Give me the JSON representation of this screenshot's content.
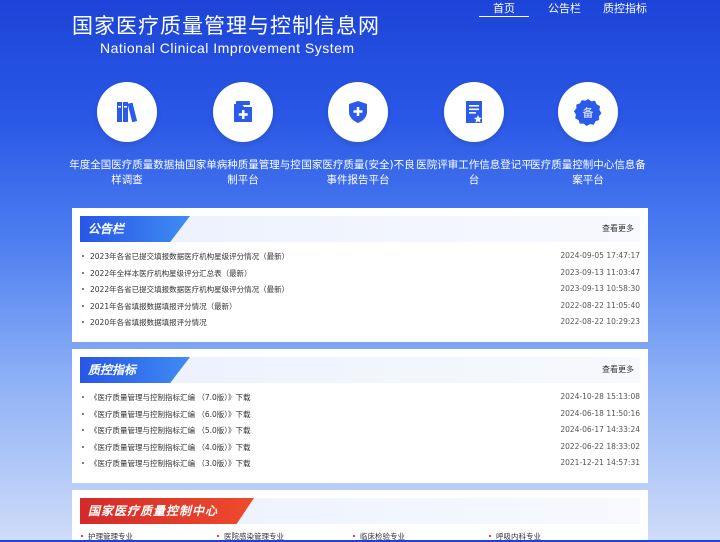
{
  "header": {
    "title": "国家医疗质量管理与控制信息网",
    "subtitle": "National Clinical Improvement System",
    "nav": [
      {
        "label": "首页",
        "active": true
      },
      {
        "label": "公告栏",
        "active": false
      },
      {
        "label": "质控指标",
        "active": false
      }
    ]
  },
  "platforms": [
    {
      "icon": "books-icon",
      "label": "年度全国医疗质量数据抽样调查"
    },
    {
      "icon": "medical-folder-icon",
      "label": "国家单病种质量管理与控制平台"
    },
    {
      "icon": "shield-plus-icon",
      "label": "国家医疗质量(安全)不良事件报告平台"
    },
    {
      "icon": "certificate-icon",
      "label": "医院评审工作信息登记平台"
    },
    {
      "icon": "record-badge-icon",
      "label": "医疗质量控制中心信息备案平台"
    }
  ],
  "badge_glyph": "备",
  "announcements": {
    "title": "公告栏",
    "more": "查看更多",
    "items": [
      {
        "text": "2023年各省已提交填报数据医疗机构星级评分情况（最新）",
        "date": "2024-09-05 17:47:17"
      },
      {
        "text": "2022年全样本医疗机构星级评分汇总表（最新）",
        "date": "2023-09-13 11:03:47"
      },
      {
        "text": "2022年各省已提交填报数据医疗机构星级评分情况（最新）",
        "date": "2023-09-13 10:58:30"
      },
      {
        "text": "2021年各省填报数据填报评分情况（最新）",
        "date": "2022-08-22 11:05:40"
      },
      {
        "text": "2020年各省填报数据填报评分情况",
        "date": "2022-08-22 10:29:23"
      }
    ]
  },
  "indicators": {
    "title": "质控指标",
    "more": "查看更多",
    "items": [
      {
        "text": "《医疗质量管理与控制指标汇编 （7.0版）》下载",
        "date": "2024-10-28 15:13:08"
      },
      {
        "text": "《医疗质量管理与控制指标汇编 （6.0版）》下载",
        "date": "2024-06-18 11:50:16"
      },
      {
        "text": "《医疗质量管理与控制指标汇编 （5.0版）》下载",
        "date": "2024-06-17 14:33:24"
      },
      {
        "text": "《医疗质量管理与控制指标汇编 （4.0版）》下载",
        "date": "2022-06-22 18:33:02"
      },
      {
        "text": "《医疗质量管理与控制指标汇编 （3.0版）》下载",
        "date": "2021-12-21 14:57:31"
      }
    ]
  },
  "control_center": {
    "title": "国家医疗质量控制中心",
    "items": [
      "护理管理专业",
      "医院感染管理专业",
      "临床检验专业",
      "呼吸内科专业"
    ]
  },
  "colors": {
    "accent_blue": "#2756e6",
    "accent_red": "#d32a2a",
    "icon_blue": "#2b5be8"
  }
}
